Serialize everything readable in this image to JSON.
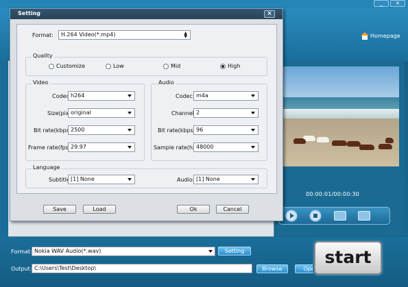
{
  "app": {
    "homepage_label": "Homepage",
    "time_display": "00:00:01/00:00:30",
    "bottom": {
      "format_label": "Format:",
      "format_value": "Nokia WAV Audio(*.wav)",
      "setting_button": "Setting",
      "output_label": "Output:",
      "output_value": "C:\\Users\\Test\\Desktop\\",
      "browse_button": "Browse",
      "open_button": "Open",
      "start_button": "start"
    }
  },
  "dialog": {
    "title": "Setting",
    "format_label": "Format:",
    "format_value": "H.264 Video(*.mp4)",
    "quality": {
      "title": "Quality",
      "options": [
        "Customize",
        "Low",
        "Mid",
        "High"
      ],
      "selected": "High"
    },
    "video": {
      "title": "Video",
      "codec_label": "Codec:",
      "codec_value": "h264",
      "size_label": "Size(pix):",
      "size_value": "original",
      "bitrate_label": "Bit rate(kbps):",
      "bitrate_value": "2500",
      "framerate_label": "Frame rate(fps):",
      "framerate_value": "29.97"
    },
    "audio": {
      "title": "Audio",
      "codec_label": "Codec:",
      "codec_value": "m4a",
      "channel_label": "Channel:",
      "channel_value": "2",
      "bitrate_label": "Bit rate(kbps):",
      "bitrate_value": "96",
      "samplerate_label": "Sample rate(hz):",
      "samplerate_value": "48000"
    },
    "language": {
      "title": "Language",
      "subtitle_label": "Subtitle:",
      "subtitle_value": "[1] None",
      "audio_label": "Audio:",
      "audio_value": "[1] None"
    },
    "buttons": {
      "save": "Save",
      "load": "Load",
      "ok": "Ok",
      "cancel": "Cancel"
    }
  }
}
